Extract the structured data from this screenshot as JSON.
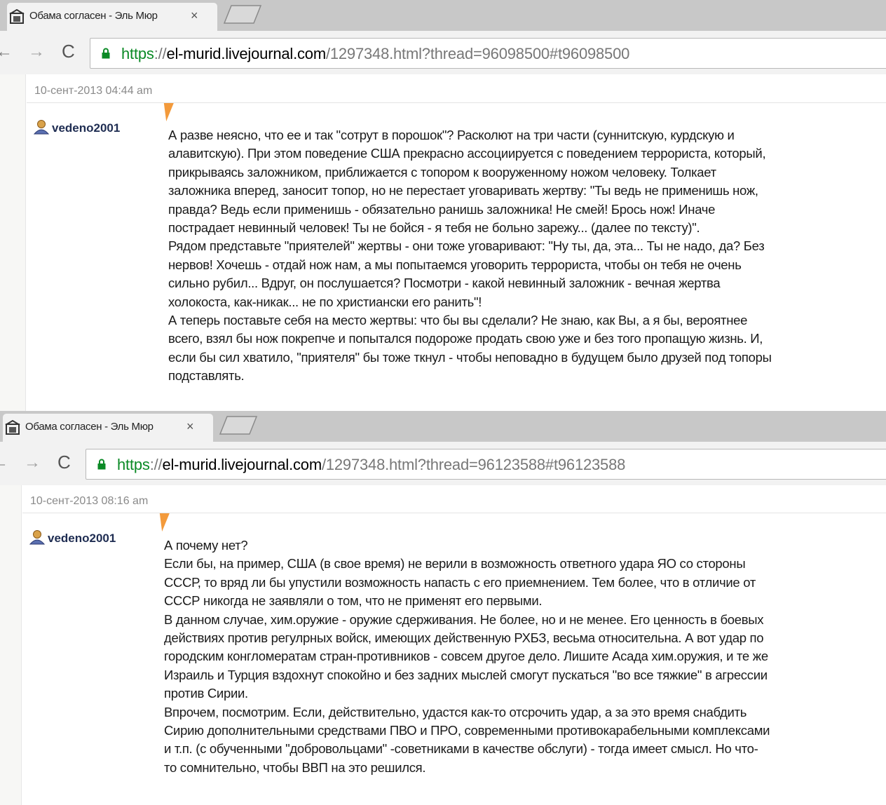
{
  "colors": {
    "url_scheme": "#0b8a26",
    "username": "#1f2d52",
    "marker": "#f39a3b",
    "tab_strip": "#c8c8c8"
  },
  "screens": [
    {
      "tab_title": "Обама согласен - Эль Мюр",
      "url": {
        "scheme": "https",
        "sep": "://",
        "host": "el-murid.livejournal.com",
        "path": "/1297348.html?thread=96098500#t96098500"
      },
      "date": "10-сент-2013 04:44 am",
      "username": "vedeno2001",
      "comment": "А разве неясно, что ее и так \"сотрут в порошок\"? Расколют на три части (суннитскую, курдскую и\nалавитскую). При этом поведение США прекрасно ассоциируется с поведением террориста, который,\nприкрываясь заложником, приближается с топором к вооруженному ножом человеку. Толкает\nзаложника вперед, заносит топор, но не перестает уговаривать жертву: \"Ты ведь не применишь нож,\nправда? Ведь если применишь - обязательно ранишь заложника! Не смей! Брось нож! Иначе\nпострадает невинный человек! Ты не бойся - я тебя не больно зарежу... (далее по тексту)\".\nРядом представьте \"приятелей\" жертвы - они тоже уговаривают: \"Ну ты, да, эта... Ты не надо, да? Без\nнервов! Хочешь - отдай нож нам, а мы попытаемся уговорить террориста, чтобы он тебя не очень\nсильно рубил... Вдруг, он послушается? Посмотри - какой невинный заложник - вечная жертва\nхолокоста, как-никак... не по христиански его ранить\"!\nА теперь поставьте себя на место жертвы: что бы вы сделали? Не знаю, как Вы, а я бы, вероятнее\nвсего, взял бы нож покрепче и попытался подороже продать свою уже и без того пропащую жизнь. И,\nесли бы сил хватило, \"приятеля\" бы тоже ткнул - чтобы неповадно в будущем было друзей под топоры\nподставлять."
    },
    {
      "tab_title": "Обама согласен - Эль Мюр",
      "url": {
        "scheme": "https",
        "sep": "://",
        "host": "el-murid.livejournal.com",
        "path": "/1297348.html?thread=96123588#t96123588"
      },
      "date": "10-сент-2013 08:16 am",
      "username": "vedeno2001",
      "comment": "А почему нет?\nЕсли бы, на пример, США (в свое время) не верили в возможность ответного удара ЯО со стороны\nСССР, то вряд ли бы упустили возможность напасть с его приемнением. Тем более, что в отличие от\nСССР никогда не заявляли о том, что не применят его первыми.\nВ данном случае, хим.оружие - оружие сдерживания. Не более, но и не менее. Его ценность в боевых\nдействиях против регулрных войск, имеющих действенную РХБЗ, весьма относительна. А вот удар по\nгородским конгломератам стран-противников - совсем другое дело. Лишите Асада хим.оружия, и те же\nИзраиль и Турция вздохнут спокойно и без задних мыслей смогут пускаться \"во все тяжкие\" в агрессии\nпротив Сирии.\nВпрочем, посмотрим. Если, действительно, удастся как-то отсрочить удар, а за это время снабдить\nСирию дополнительными средствами ПВО и ПРО, современными противокарабельными комплексами\nи т.п. (с обученными \"добровольцами\" -советниками в качестве обслуги) - тогда имеет смысл. Но что-\nто сомнительно, чтобы ВВП на это решился."
    }
  ],
  "icons": {
    "favicon": "livejournal-favicon-icon",
    "close": "close-icon",
    "back": "back-arrow-icon",
    "forward": "forward-arrow-icon",
    "reload": "reload-icon",
    "lock": "lock-icon",
    "user": "user-icon"
  },
  "glyphs": {
    "close": "×",
    "back": "←",
    "forward": "→",
    "reload": "C"
  }
}
